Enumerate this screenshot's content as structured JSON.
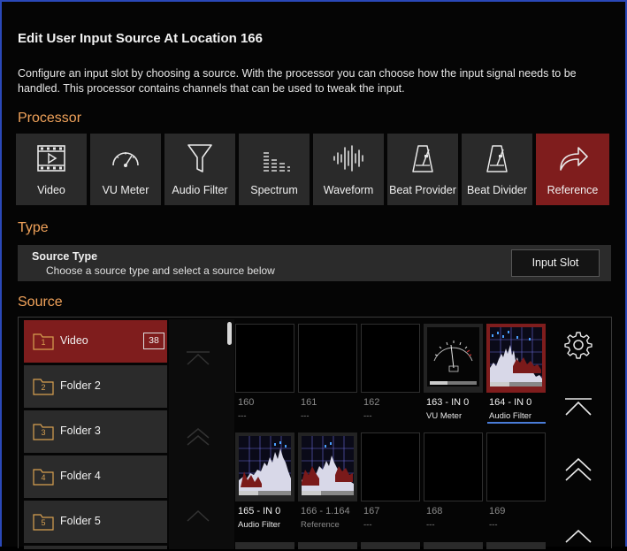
{
  "dialog": {
    "title": "Edit User Input Source At Location 166",
    "description": "Configure an input slot by choosing a source. With the processor you can choose how the input signal needs to be handled. This processor contains channels that can be used to tweak the input."
  },
  "sections": {
    "processor": "Processor",
    "type": "Type",
    "source": "Source"
  },
  "processors": [
    {
      "label": "Video",
      "icon": "film-icon",
      "selected": false
    },
    {
      "label": "VU Meter",
      "icon": "gauge-icon",
      "selected": false
    },
    {
      "label": "Audio Filter",
      "icon": "funnel-icon",
      "selected": false
    },
    {
      "label": "Spectrum",
      "icon": "spectrum-icon",
      "selected": false
    },
    {
      "label": "Waveform",
      "icon": "waveform-icon",
      "selected": false
    },
    {
      "label": "Beat Provider",
      "icon": "metronome-icon",
      "selected": false
    },
    {
      "label": "Beat Divider",
      "icon": "metronome-icon",
      "selected": false
    },
    {
      "label": "Reference",
      "icon": "share-arrow-icon",
      "selected": true
    }
  ],
  "type_panel": {
    "title": "Source Type",
    "subtitle": "Choose a source type and select a source below",
    "button_label": "Input Slot"
  },
  "folders": [
    {
      "number": "1",
      "label": "Video",
      "count": "38",
      "selected": true
    },
    {
      "number": "2",
      "label": "Folder 2",
      "selected": false
    },
    {
      "number": "3",
      "label": "Folder 3",
      "selected": false
    },
    {
      "number": "4",
      "label": "Folder 4",
      "selected": false
    },
    {
      "number": "5",
      "label": "Folder 5",
      "selected": false
    }
  ],
  "tiles": [
    {
      "name": "160",
      "sub": "---",
      "thumb": "none",
      "selected": false,
      "active": false
    },
    {
      "name": "161",
      "sub": "---",
      "thumb": "none",
      "selected": false,
      "active": false
    },
    {
      "name": "162",
      "sub": "---",
      "thumb": "none",
      "selected": false,
      "active": false
    },
    {
      "name": "163 - IN 0",
      "sub": "VU Meter",
      "thumb": "vu-meter",
      "selected": false,
      "active": true
    },
    {
      "name": "164 - IN 0",
      "sub": "Audio Filter",
      "thumb": "spectrum",
      "selected": true,
      "active": true
    },
    {
      "name": "165 - IN 0",
      "sub": "Audio Filter",
      "thumb": "spectrum",
      "selected": false,
      "active": true
    },
    {
      "name": "166 - 1.164",
      "sub": "Reference",
      "thumb": "spectrum",
      "selected": false,
      "active": false
    },
    {
      "name": "167",
      "sub": "---",
      "thumb": "none",
      "selected": false,
      "active": false
    },
    {
      "name": "168",
      "sub": "---",
      "thumb": "none",
      "selected": false,
      "active": false
    },
    {
      "name": "169",
      "sub": "---",
      "thumb": "none",
      "selected": false,
      "active": false
    }
  ],
  "tools": [
    "gear-icon",
    "scroll-top-icon",
    "page-up-icon",
    "line-up-icon"
  ],
  "colors": {
    "accent_selected": "#7f1d1d",
    "section_header": "#f0a25a",
    "window_border": "#2a48b8",
    "underline": "#4a7cd8"
  }
}
